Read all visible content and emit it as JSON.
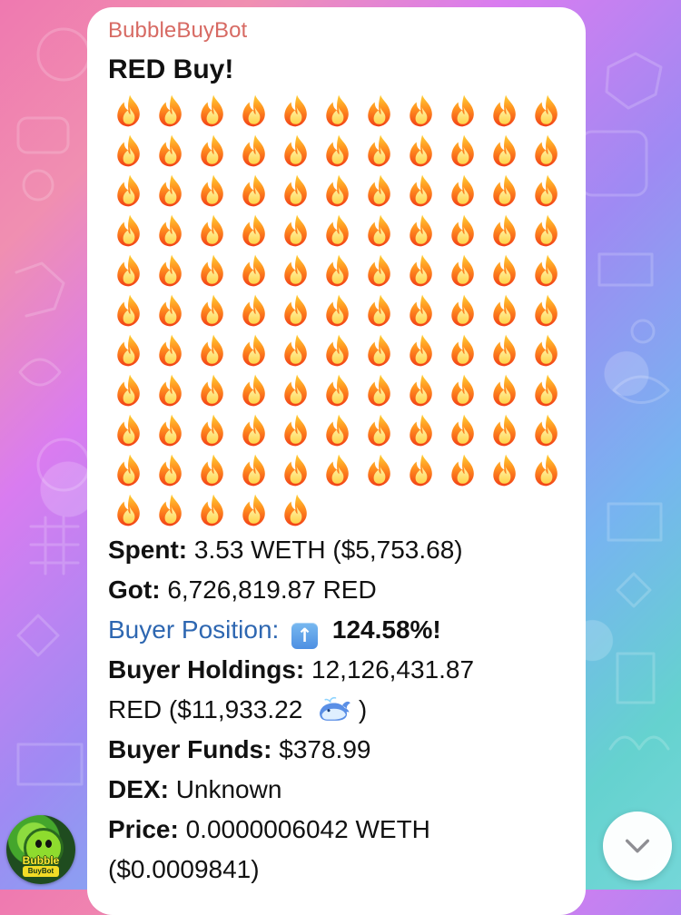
{
  "message": {
    "sender": "BubbleBuyBot",
    "headline": "RED Buy!",
    "fire_rows": [
      11,
      11,
      11,
      11,
      11,
      11,
      11,
      11,
      11,
      11,
      5
    ],
    "details": {
      "spent_label": "Spent:",
      "spent_value": "3.53 WETH ($5,753.68)",
      "got_label": "Got:",
      "got_value": "6,726,819.87 RED",
      "buyer_position_label": "Buyer Position:",
      "buyer_position_value": "124.58%!",
      "buyer_holdings_label": "Buyer Holdings:",
      "buyer_holdings_value_line1": "12,126,431.87",
      "buyer_holdings_value_line2": "RED ($11,933.22",
      "buyer_funds_label": "Buyer Funds:",
      "buyer_funds_value": "$378.99",
      "dex_label": "DEX:",
      "dex_value": "Unknown",
      "price_label": "Price:",
      "price_value_line1": "0.0000006042 WETH",
      "price_value_line2": "($0.0009841)"
    }
  },
  "avatar": {
    "logo_text": "Bubble",
    "subtext": "BuyBot"
  },
  "icons": {
    "fire": "fire-icon",
    "up_arrow": "up-arrow-icon",
    "whale": "whale-icon",
    "scroll_down": "chevron-down-icon"
  },
  "colors": {
    "sender": "#d76a63",
    "link_blue": "#2e67b1",
    "bubble": "#ffffff"
  }
}
